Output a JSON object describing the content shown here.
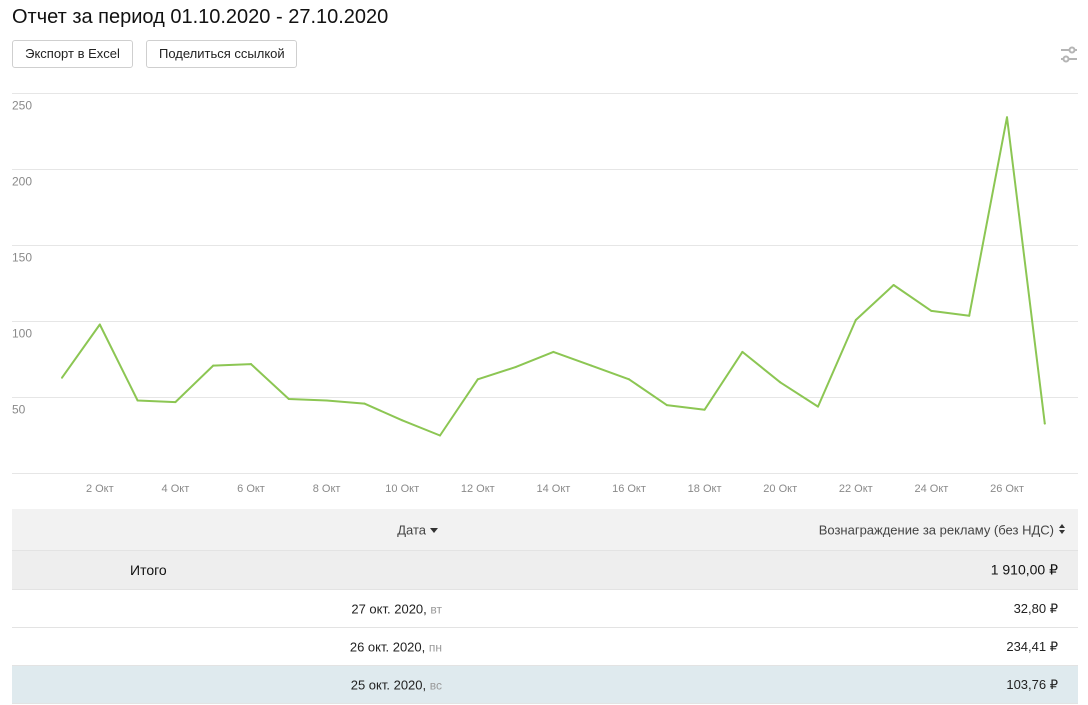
{
  "header": {
    "title": "Отчет за период 01.10.2020 - 27.10.2020"
  },
  "toolbar": {
    "export_label": "Экспорт в Excel",
    "share_label": "Поделиться ссылкой",
    "settings_icon": "sliders-icon"
  },
  "colors": {
    "line": "#8cc653",
    "grid": "#e6e6e6",
    "tick": "#8a8a8a",
    "highlight_row": "#dfeaee",
    "header_row": "#f2f2f2"
  },
  "chart_data": {
    "type": "line",
    "x": [
      "01.10.2020",
      "02.10.2020",
      "03.10.2020",
      "04.10.2020",
      "05.10.2020",
      "06.10.2020",
      "07.10.2020",
      "08.10.2020",
      "09.10.2020",
      "10.10.2020",
      "11.10.2020",
      "12.10.2020",
      "13.10.2020",
      "14.10.2020",
      "15.10.2020",
      "16.10.2020",
      "17.10.2020",
      "18.10.2020",
      "19.10.2020",
      "20.10.2020",
      "21.10.2020",
      "22.10.2020",
      "23.10.2020",
      "24.10.2020",
      "25.10.2020",
      "26.10.2020",
      "27.10.2020"
    ],
    "x_tick_labels": [
      {
        "index": 1,
        "label": "2 Окт"
      },
      {
        "index": 3,
        "label": "4 Окт"
      },
      {
        "index": 5,
        "label": "6 Окт"
      },
      {
        "index": 7,
        "label": "8 Окт"
      },
      {
        "index": 9,
        "label": "10 Окт"
      },
      {
        "index": 11,
        "label": "12 Окт"
      },
      {
        "index": 13,
        "label": "14 Окт"
      },
      {
        "index": 15,
        "label": "16 Окт"
      },
      {
        "index": 17,
        "label": "18 Окт"
      },
      {
        "index": 19,
        "label": "20 Окт"
      },
      {
        "index": 21,
        "label": "22 Окт"
      },
      {
        "index": 23,
        "label": "24 Окт"
      },
      {
        "index": 25,
        "label": "26 Окт"
      }
    ],
    "series": [
      {
        "values": [
          63,
          98,
          48,
          47,
          71,
          72,
          49,
          48,
          46,
          35,
          25,
          62,
          70,
          80,
          71,
          62,
          45,
          42,
          80,
          60,
          44,
          101,
          124,
          107,
          103.76,
          234.41,
          32.8
        ]
      }
    ],
    "yticks": [
      50,
      100,
      150,
      200,
      250
    ],
    "ylim": [
      0,
      260
    ],
    "grid": true,
    "title": "",
    "xlabel": "",
    "ylabel": ""
  },
  "table": {
    "col_date": "Дата",
    "col_reward": "Вознаграждение за рекламу (без НДС)",
    "total_label": "Итого",
    "total_value": "1 910,00 ₽",
    "rows": [
      {
        "date": "27 окт. 2020,",
        "weekday": "вт",
        "value": "32,80 ₽"
      },
      {
        "date": "26 окт. 2020,",
        "weekday": "пн",
        "value": "234,41 ₽"
      },
      {
        "date": "25 окт. 2020,",
        "weekday": "вс",
        "value": "103,76 ₽"
      }
    ]
  }
}
